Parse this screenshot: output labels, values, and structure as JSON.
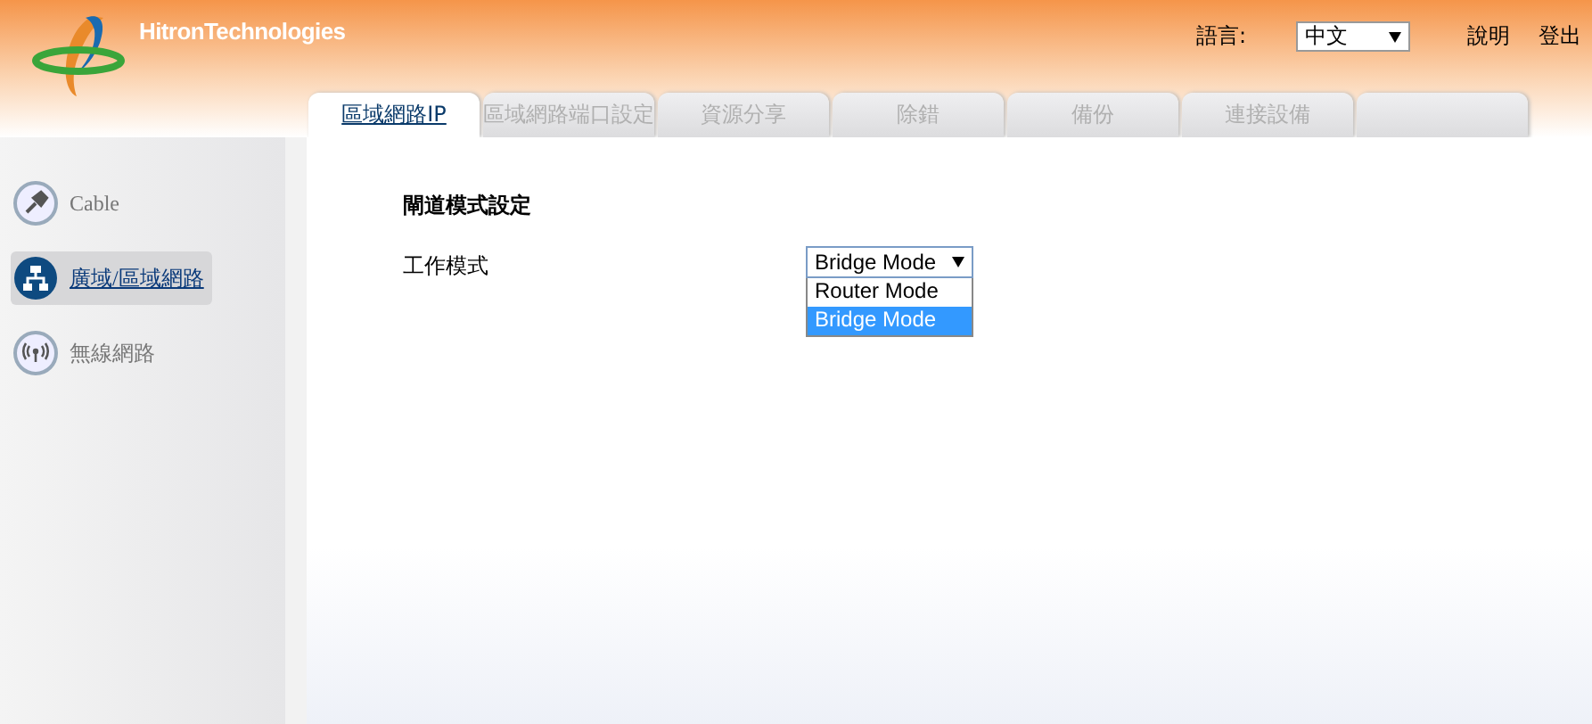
{
  "header": {
    "brand": "HitronTechnologies",
    "language_label": "語言:",
    "language": "中文",
    "links": [
      "說明",
      "登出"
    ]
  },
  "tabs": [
    {
      "label": "區域網路IP",
      "selected": true
    },
    {
      "label": "區域網路端口設定",
      "selected": false
    },
    {
      "label": "資源分享",
      "selected": false
    },
    {
      "label": "除錯",
      "selected": false
    },
    {
      "label": "備份",
      "selected": false
    },
    {
      "label": "連接設備",
      "selected": false
    }
  ],
  "sidebar": {
    "items": [
      {
        "label": "Cable",
        "kind": "plug",
        "selected": false
      },
      {
        "label": "廣域/區域網路",
        "kind": "network",
        "selected": true
      },
      {
        "label": "無線網路",
        "kind": "wireless",
        "selected": false
      }
    ]
  },
  "section_title": "閘道模式設定",
  "field": {
    "label": "工作模式",
    "value": "Bridge Mode",
    "options": [
      {
        "label": "Router Mode",
        "selected": false
      },
      {
        "label": "Bridge Mode",
        "selected": true
      }
    ]
  }
}
